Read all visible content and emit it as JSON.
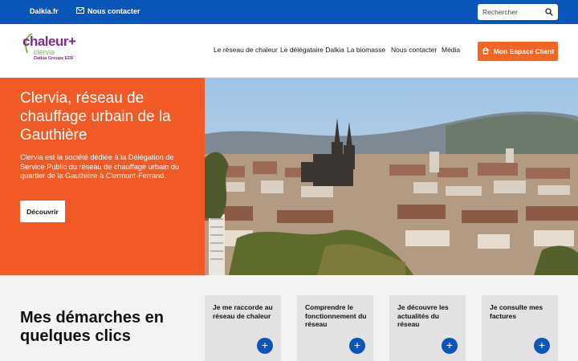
{
  "topbar": {
    "site_link": "Dalkia.fr",
    "contact_link": "Nous contacter",
    "search_placeholder": "Rechercher"
  },
  "logo": {
    "brand": "chaleur+",
    "sub": "clervia",
    "group": "Dalkia Groupe EDF"
  },
  "nav": {
    "items": [
      "Le réseau de chaleur",
      "Le délégataire Dalkia",
      "La biomasse",
      "Nous contacter",
      "Média"
    ],
    "cta_label": "Mon Espace Client"
  },
  "hero": {
    "title": "Clervia, réseau de chauffage urbain de la Gauthière",
    "text": "Clervia est la société dédiée à la Délégation de Service Public du réseau de chauffage urbain du quartier de la Gauthière à Clermont-Ferrand.",
    "button_label": "Découvrir"
  },
  "demarches": {
    "title": "Mes démarches en quelques clics",
    "cards": [
      "Je me raccorde au réseau de chaleur",
      "Comprendre le fonctionnement du réseau",
      "Je découvre les actualités du réseau",
      "Je consulte mes factures"
    ],
    "plus_symbol": "+"
  },
  "colors": {
    "topbar": "#0a56b8",
    "accent_orange": "#f15a24",
    "cta_orange": "#f26522",
    "brand_purple": "#7b2a86",
    "brand_green": "#7ab648"
  }
}
